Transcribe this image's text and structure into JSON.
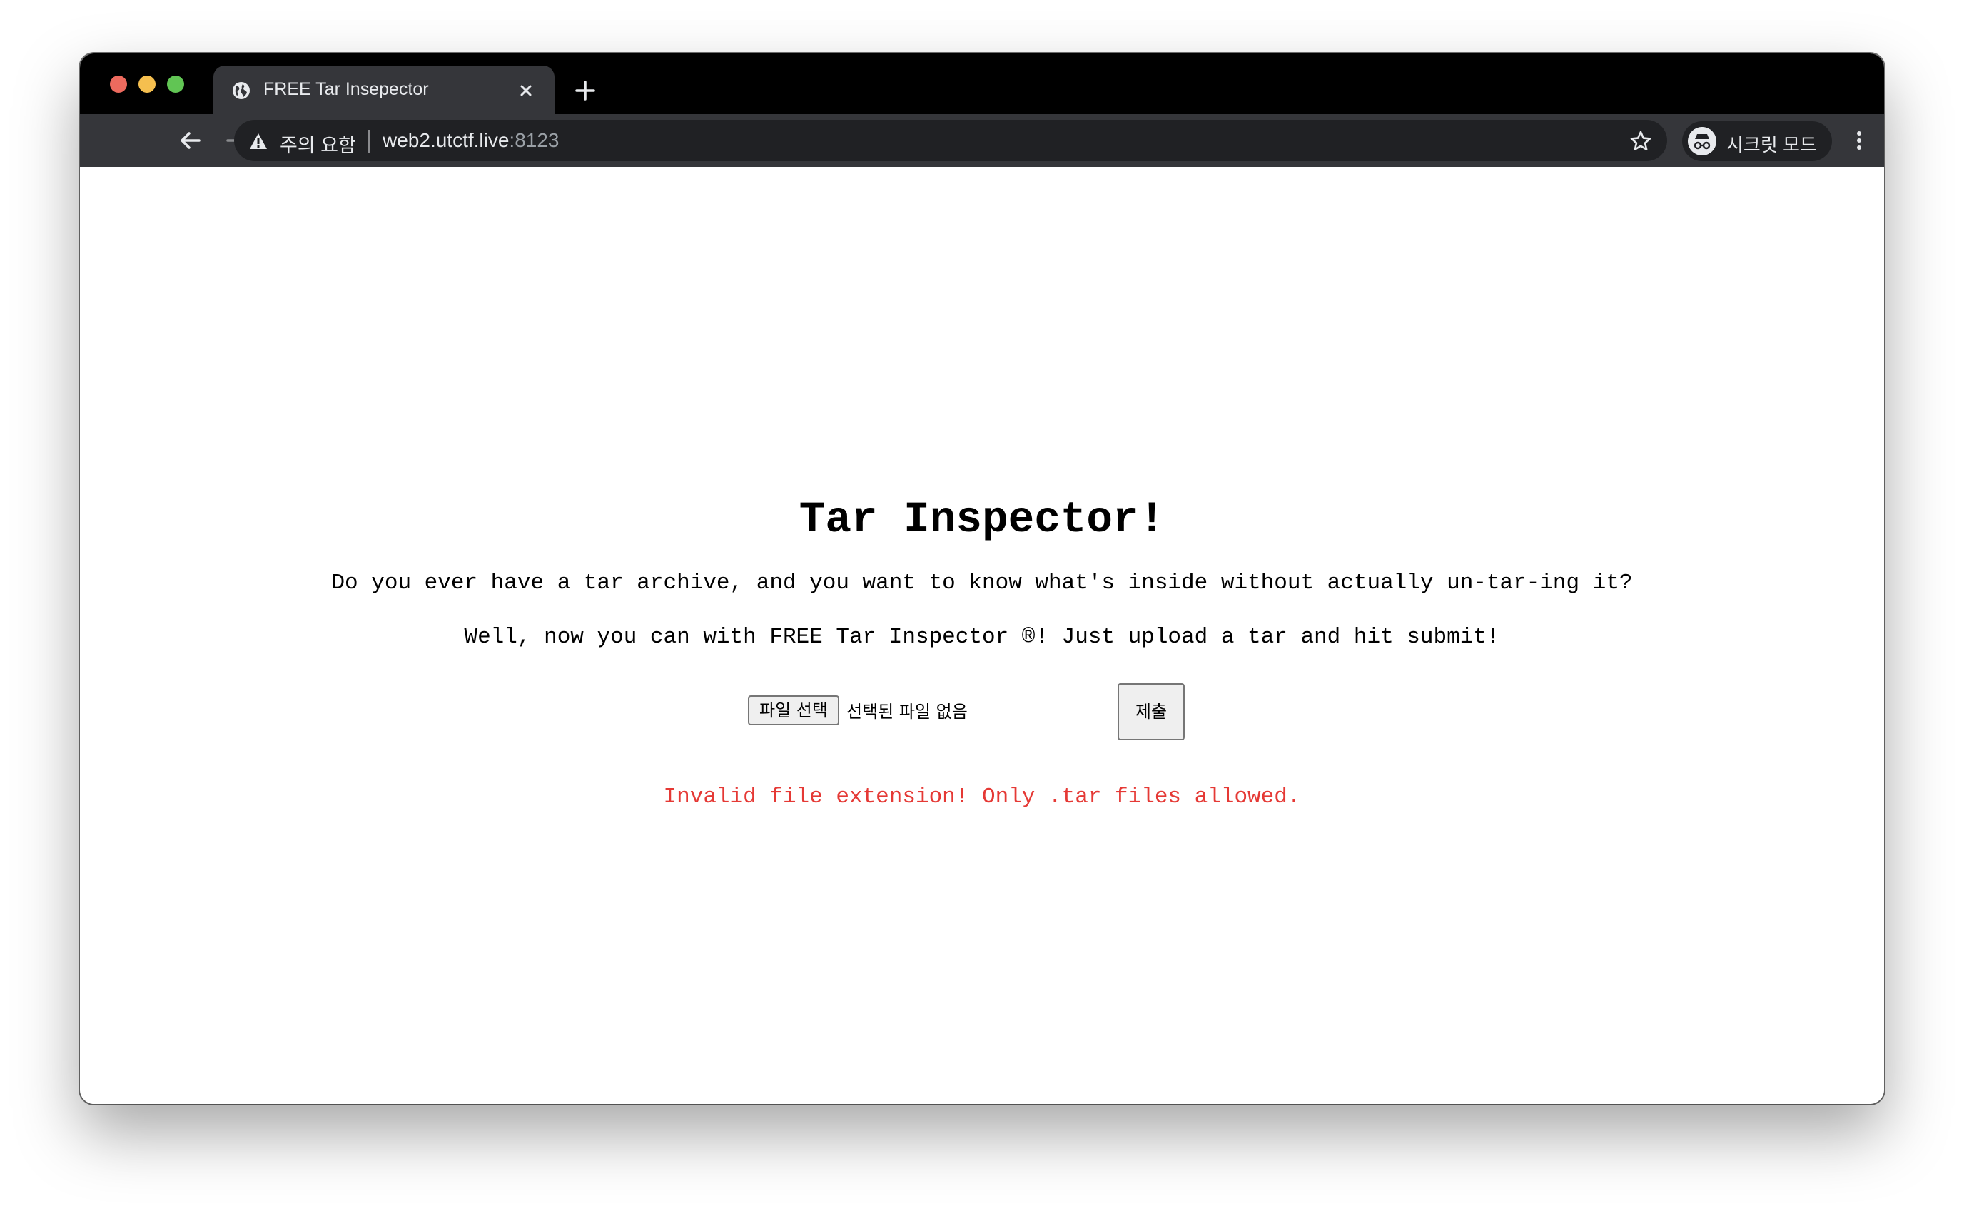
{
  "browser": {
    "tab_title": "FREE Tar Insepector",
    "security_label": "주의 요함",
    "url_host": "web2.utctf.live",
    "url_port": ":8123",
    "incognito_label": "시크릿 모드",
    "icons": [
      "globe-icon",
      "close-icon",
      "plus-icon",
      "back-arrow-icon",
      "forward-arrow-icon",
      "reload-icon",
      "warning-icon",
      "star-icon",
      "incognito-icon",
      "more-vert-icon"
    ]
  },
  "page": {
    "heading": "Tar Inspector!",
    "intro": "Do you ever have a tar archive, and you want to know what's inside without actually un-tar-ing it?",
    "pitch": "Well, now you can with FREE Tar Inspector ®! Just upload a tar and hit submit!",
    "choose_file_label": "파일 선택",
    "no_file_text": "선택된 파일 없음",
    "submit_label": "제출",
    "error_message": "Invalid file extension! Only .tar files allowed.",
    "error_color": "#e53935"
  }
}
